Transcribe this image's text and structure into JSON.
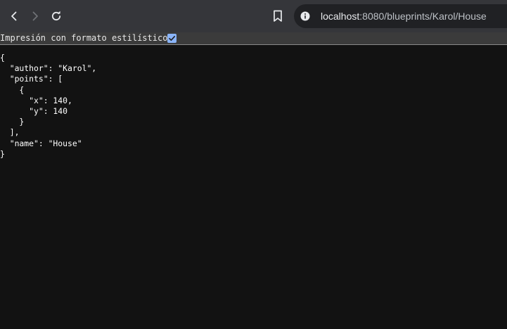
{
  "browser": {
    "back_icon": "chevron-left-icon",
    "forward_icon": "chevron-right-icon",
    "reload_icon": "reload-icon",
    "bookmark_icon": "bookmark-icon",
    "site_info_icon": "info-icon",
    "url_host": "localhost",
    "url_rest": ":8080/blueprints/Karol/House"
  },
  "pretty_print": {
    "label": "Impresión con formato estilístico",
    "checked": true,
    "check_color": "#8ab4f8"
  },
  "json_lines": [
    "{",
    "  \"author\": \"Karol\",",
    "  \"points\": [",
    "    {",
    "      \"x\": 140,",
    "      \"y\": 140",
    "    }",
    "  ],",
    "  \"name\": \"House\"",
    "}"
  ]
}
